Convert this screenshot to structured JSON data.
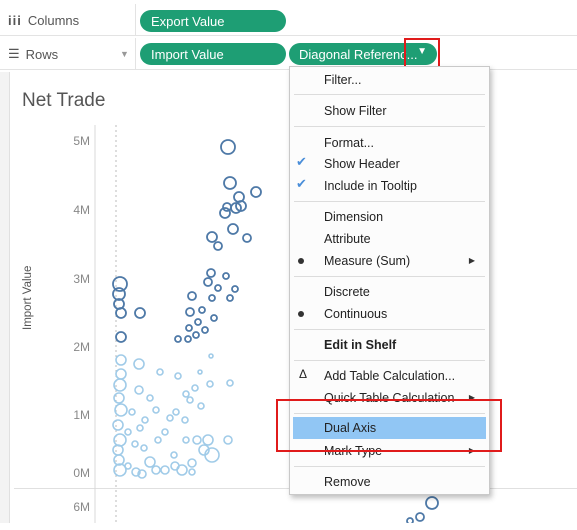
{
  "shelves": {
    "columns_label": "Columns",
    "rows_label": "Rows",
    "columns_pill": "Export Value",
    "rows_pill_1": "Import Value",
    "rows_pill_2": "Diagonal Referenc..."
  },
  "sheet": {
    "title": "Net Trade",
    "y_axis_label": "Import Value",
    "y_ticks": [
      "5M",
      "4M",
      "3M",
      "2M",
      "1M",
      "0M",
      "6M"
    ]
  },
  "menu": {
    "filter": "Filter...",
    "show_filter": "Show Filter",
    "format": "Format...",
    "show_header": "Show Header",
    "include_tooltip": "Include in Tooltip",
    "dimension": "Dimension",
    "attribute": "Attribute",
    "measure": "Measure (Sum)",
    "discrete": "Discrete",
    "continuous": "Continuous",
    "edit_in_shelf": "Edit in Shelf",
    "add_table_calc": "Add Table Calculation...",
    "quick_table_calc": "Quick Table Calculation",
    "dual_axis": "Dual Axis",
    "mark_type": "Mark Type",
    "remove": "Remove"
  },
  "colors": {
    "pill_green": "#1e9e74",
    "highlight_blue": "#91c6f4",
    "mark_dark": "#4e79a7",
    "mark_light": "#a0cbe8",
    "annotation_red": "#e01b1b"
  }
}
